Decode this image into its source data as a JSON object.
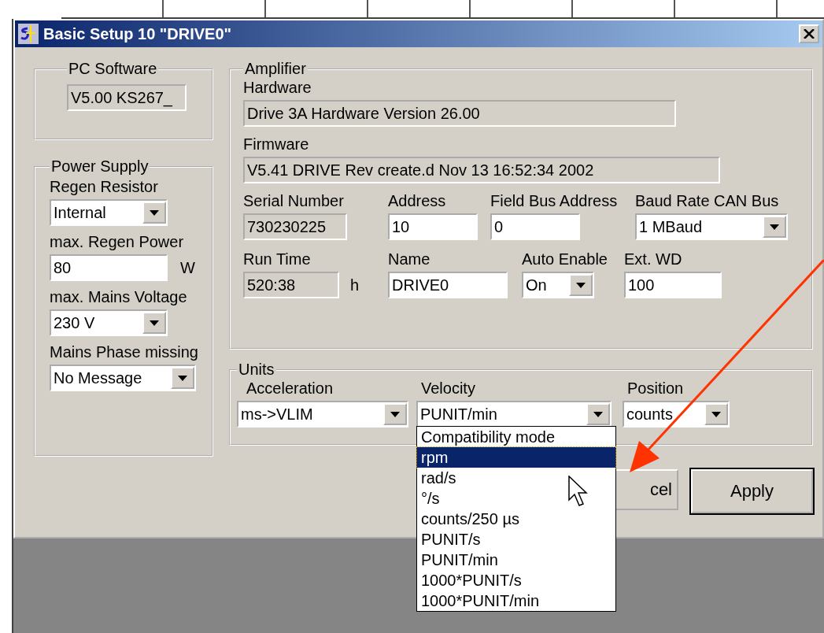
{
  "window": {
    "title": "Basic Setup 10 \"DRIVE0\""
  },
  "pc_software": {
    "title": "PC Software",
    "version": "V5.00 KS267_"
  },
  "power_supply": {
    "title": "Power Supply",
    "fields": [
      {
        "kind": "select",
        "label": "Regen Resistor",
        "value": "Internal"
      },
      {
        "kind": "input",
        "label": "max. Regen Power",
        "value": "80",
        "unit": "W"
      },
      {
        "kind": "select",
        "label": "max. Mains Voltage",
        "value": "230 V"
      },
      {
        "kind": "select",
        "label": "Mains Phase missing",
        "value": "No Message"
      }
    ]
  },
  "amplifier": {
    "title": "Amplifier",
    "hardware": {
      "label": "Hardware",
      "value": "Drive 3A Hardware Version 26.00"
    },
    "firmware": {
      "label": "Firmware",
      "value": "V5.41 DRIVE Rev create.d Nov 13 16:52:34 2002"
    },
    "row_1": [
      {
        "kind": "readonly",
        "label": "Serial Number",
        "value": "730230225"
      },
      {
        "kind": "input",
        "label": "Address",
        "value": "10"
      },
      {
        "kind": "input",
        "label": "Field Bus Address",
        "value": "0"
      },
      {
        "kind": "select",
        "label": "Baud Rate CAN Bus",
        "value": "1 MBaud"
      }
    ],
    "row_2": [
      {
        "kind": "readonly",
        "label": "Run Time",
        "value": "520:38",
        "unit": "h"
      },
      {
        "kind": "input",
        "label": "Name",
        "value": "DRIVE0"
      },
      {
        "kind": "select",
        "label": "Auto Enable",
        "value": "On"
      },
      {
        "kind": "input",
        "label": "Ext. WD",
        "value": "100"
      }
    ]
  },
  "units": {
    "title": "Units",
    "fields": [
      {
        "label": "Acceleration",
        "value": "ms->VLIM",
        "expanded": false
      },
      {
        "label": "Velocity",
        "value": "PUNIT/min",
        "expanded": true,
        "options": [
          {
            "label": "Compatibility mode",
            "highlighted": false
          },
          {
            "label": "rpm",
            "highlighted": true
          },
          {
            "label": "rad/s",
            "highlighted": false
          },
          {
            "label": "°/s",
            "highlighted": false
          },
          {
            "label": "counts/250 µs",
            "highlighted": false
          },
          {
            "label": "PUNIT/s",
            "highlighted": false
          },
          {
            "label": "PUNIT/min",
            "highlighted": false
          },
          {
            "label": "1000*PUNIT/s",
            "highlighted": false
          },
          {
            "label": "1000*PUNIT/min",
            "highlighted": false
          }
        ]
      },
      {
        "label": "Position",
        "value": "counts",
        "expanded": false
      }
    ]
  },
  "buttons": [
    {
      "label": "cel",
      "default": false
    },
    {
      "label": "Apply",
      "default": true
    }
  ]
}
